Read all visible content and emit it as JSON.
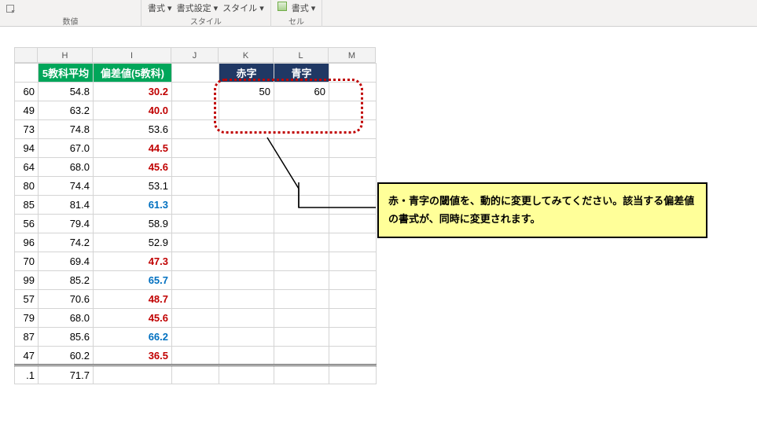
{
  "ribbon": {
    "group1": {
      "item1": "書式 ▾",
      "item2": "書式設定 ▾",
      "item3": "スタイル ▾",
      "label": "スタイル"
    },
    "group2": {
      "item1": "書式 ▾",
      "label": "セル"
    },
    "group_num": {
      "label": "数値"
    }
  },
  "columns": {
    "G": "",
    "H": "H",
    "I": "I",
    "J": "J",
    "K": "K",
    "L": "L",
    "M": "M"
  },
  "headers": {
    "H": "5教科平均",
    "I": "偏差値(5教科)"
  },
  "thresholds": {
    "red_label": "赤字",
    "blue_label": "青字",
    "red_value": 50,
    "blue_value": 60
  },
  "rows": [
    {
      "g": "60",
      "h": "54.8",
      "i": "30.2",
      "cls": "red"
    },
    {
      "g": "49",
      "h": "63.2",
      "i": "40.0",
      "cls": "red"
    },
    {
      "g": "73",
      "h": "74.8",
      "i": "53.6",
      "cls": ""
    },
    {
      "g": "94",
      "h": "67.0",
      "i": "44.5",
      "cls": "red"
    },
    {
      "g": "64",
      "h": "68.0",
      "i": "45.6",
      "cls": "red"
    },
    {
      "g": "80",
      "h": "74.4",
      "i": "53.1",
      "cls": ""
    },
    {
      "g": "85",
      "h": "81.4",
      "i": "61.3",
      "cls": "blue"
    },
    {
      "g": "56",
      "h": "79.4",
      "i": "58.9",
      "cls": ""
    },
    {
      "g": "96",
      "h": "74.2",
      "i": "52.9",
      "cls": ""
    },
    {
      "g": "70",
      "h": "69.4",
      "i": "47.3",
      "cls": "red"
    },
    {
      "g": "99",
      "h": "85.2",
      "i": "65.7",
      "cls": "blue"
    },
    {
      "g": "57",
      "h": "70.6",
      "i": "48.7",
      "cls": "red"
    },
    {
      "g": "79",
      "h": "68.0",
      "i": "45.6",
      "cls": "red"
    },
    {
      "g": "87",
      "h": "85.6",
      "i": "66.2",
      "cls": "blue"
    },
    {
      "g": "47",
      "h": "60.2",
      "i": "36.5",
      "cls": "red"
    }
  ],
  "summary": {
    "g": ".1",
    "h": "71.7",
    "i": ""
  },
  "note": "赤・青字の閾値を、動的に変更してみてください。該当する偏差値の書式が、同時に変更されます。",
  "chart_data": {
    "type": "table",
    "columns": [
      "5教科平均",
      "偏差値(5教科)"
    ],
    "thresholds": {
      "赤字": 50,
      "青字": 60
    },
    "values": [
      [
        54.8,
        30.2
      ],
      [
        63.2,
        40.0
      ],
      [
        74.8,
        53.6
      ],
      [
        67.0,
        44.5
      ],
      [
        68.0,
        45.6
      ],
      [
        74.4,
        53.1
      ],
      [
        81.4,
        61.3
      ],
      [
        79.4,
        58.9
      ],
      [
        74.2,
        52.9
      ],
      [
        69.4,
        47.3
      ],
      [
        85.2,
        65.7
      ],
      [
        70.6,
        48.7
      ],
      [
        68.0,
        45.6
      ],
      [
        85.6,
        66.2
      ],
      [
        60.2,
        36.5
      ]
    ],
    "summary_row": [
      71.7,
      null
    ]
  }
}
